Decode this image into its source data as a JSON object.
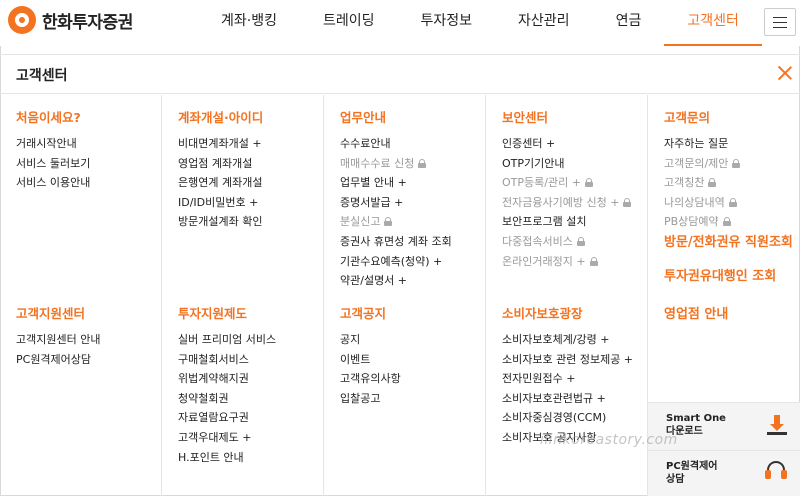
{
  "brand": {
    "name": "한화투자증권"
  },
  "nav": {
    "items": [
      "계좌·뱅킹",
      "트레이딩",
      "투자정보",
      "자산관리",
      "연금",
      "고객센터"
    ],
    "active_index": 5
  },
  "panel": {
    "title": "고객센터"
  },
  "columns": [
    {
      "sections": [
        {
          "title": "처음이세요?",
          "items": [
            {
              "label": "거래시작안내"
            },
            {
              "label": "서비스 둘러보기"
            },
            {
              "label": "서비스 이용안내"
            }
          ]
        },
        {
          "title": "고객지원센터",
          "items": [
            {
              "label": "고객지원센터 안내"
            },
            {
              "label": "PC원격제어상담"
            }
          ]
        }
      ]
    },
    {
      "sections": [
        {
          "title": "계좌개설·아이디",
          "items": [
            {
              "label": "비대면계좌개설 +"
            },
            {
              "label": "영업점 계좌개설"
            },
            {
              "label": "은행연계 계좌개설"
            },
            {
              "label": "ID/ID비밀번호 +"
            },
            {
              "label": "방문개설계좌 확인"
            }
          ]
        },
        {
          "title": "투자지원제도",
          "items": [
            {
              "label": "실버 프리미엄 서비스"
            },
            {
              "label": "구매철회서비스"
            },
            {
              "label": "위법계약해지권"
            },
            {
              "label": "청약철회권"
            },
            {
              "label": "자료열람요구권"
            },
            {
              "label": "고객우대제도 +"
            },
            {
              "label": "H.포인트 안내"
            }
          ]
        }
      ]
    },
    {
      "sections": [
        {
          "title": "업무안내",
          "items": [
            {
              "label": "수수료안내"
            },
            {
              "label": "매매수수료 신청",
              "locked": true
            },
            {
              "label": "업무별 안내 +"
            },
            {
              "label": "증명서발급 +"
            },
            {
              "label": "분실신고",
              "locked": true
            },
            {
              "label": "증권사 휴면성 계좌 조회"
            },
            {
              "label": "기관수요예측(청약) +"
            },
            {
              "label": "약관/설명서 +"
            }
          ]
        },
        {
          "title": "고객공지",
          "items": [
            {
              "label": "공지"
            },
            {
              "label": "이벤트"
            },
            {
              "label": "고객유의사항"
            },
            {
              "label": "입찰공고"
            }
          ]
        }
      ]
    },
    {
      "sections": [
        {
          "title": "보안센터",
          "items": [
            {
              "label": "인증센터 +"
            },
            {
              "label": "OTP기기안내"
            },
            {
              "label": "OTP등록/관리 +",
              "locked": true
            },
            {
              "label": "전자금융사기예방 신청 +",
              "locked": true
            },
            {
              "label": "보안프로그램 설치"
            },
            {
              "label": "다중접속서비스",
              "locked": true
            },
            {
              "label": "온라인거래정지 +",
              "locked": true
            }
          ]
        },
        {
          "title": "소비자보호광장",
          "items": [
            {
              "label": "소비자보호체계/강령 +"
            },
            {
              "label": "소비자보호 관련 정보제공 +"
            },
            {
              "label": "전자민원접수 +"
            },
            {
              "label": "소비자보호관련법규 +"
            },
            {
              "label": "소비자중심경영(CCM)"
            },
            {
              "label": "소비자보호 공지사항"
            }
          ]
        }
      ]
    },
    {
      "sections": [
        {
          "title": "고객문의",
          "items": [
            {
              "label": "자주하는 질문"
            },
            {
              "label": "고객문의/제안",
              "locked": true
            },
            {
              "label": "고객칭찬",
              "locked": true
            },
            {
              "label": "나의상담내역",
              "locked": true
            },
            {
              "label": "PB상담예약",
              "locked": true
            }
          ]
        },
        {
          "title": "방문/전화권유 직원조회",
          "items": []
        },
        {
          "title": "투자권유대행인 조회",
          "items": []
        },
        {
          "title": "영업점 안내",
          "items": []
        }
      ]
    }
  ],
  "side_box": {
    "download": {
      "line1": "Smart One",
      "line2": "다운로드",
      "icon": "download-icon"
    },
    "remote": {
      "line1": "PC원격제어",
      "line2": "상담",
      "icon": "headset-icon"
    }
  },
  "watermark": "ilinkoreastory.com",
  "colors": {
    "accent": "#f37321",
    "text": "#222222",
    "dim": "#999999"
  }
}
